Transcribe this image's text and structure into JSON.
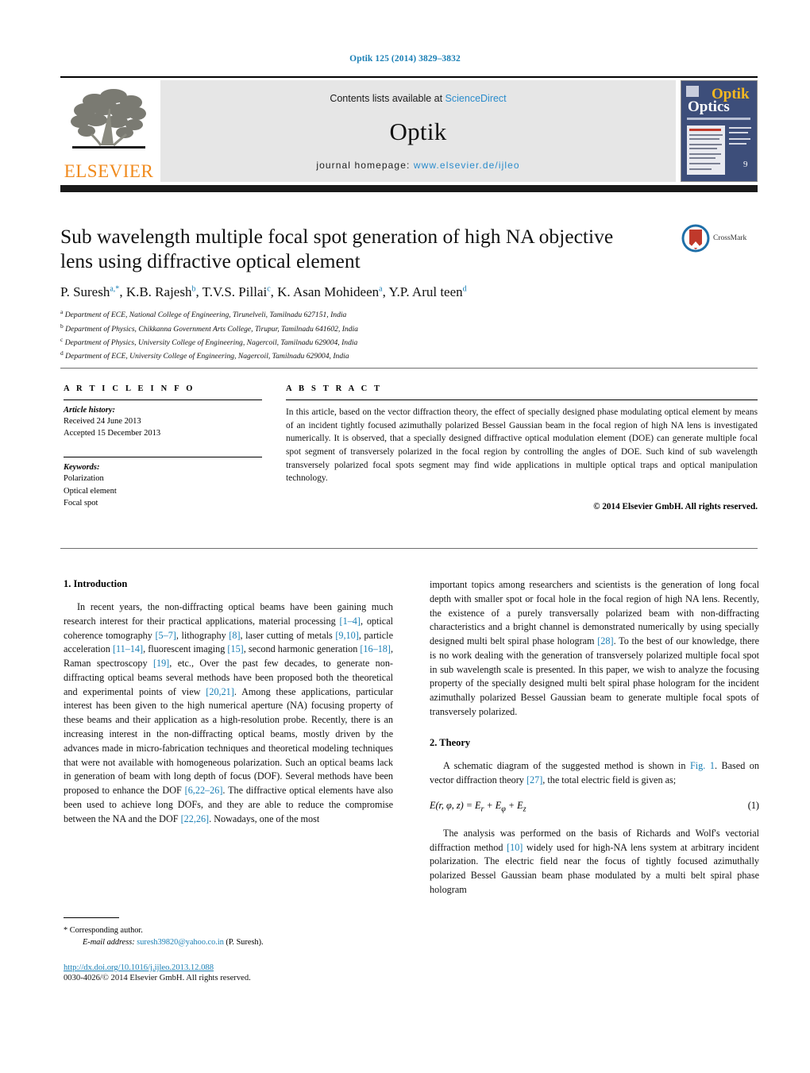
{
  "running_head": "Optik 125 (2014) 3829–3832",
  "masthead": {
    "contents_prefix": "Contents lists available at ",
    "contents_link": "ScienceDirect",
    "journal_name": "Optik",
    "homepage_prefix": "journal homepage:",
    "homepage_url": "www.elsevier.de/ijleo",
    "publisher_logo_text": "ELSEVIER",
    "cover_title_top": "Optik",
    "cover_title_bottom": "Optics"
  },
  "title": "Sub wavelength multiple focal spot generation of high NA objective lens using diffractive optical element",
  "crossmark_label": "CrossMark",
  "authors_html": "P. Suresh<sup class=\"star\">a,*</sup>, K.B. Rajesh<sup>b</sup>, T.V.S. Pillai<sup>c</sup>, K. Asan Mohideen<sup>a</sup>, Y.P. Arul teen<sup>d</sup>",
  "affiliations": [
    {
      "marker": "a",
      "text": "Department of ECE, National College of Engineering, Tirunelveli, Tamilnadu 627151, India"
    },
    {
      "marker": "b",
      "text": "Department of Physics, Chikkanna Government Arts College, Tirupur, Tamilnadu 641602, India"
    },
    {
      "marker": "c",
      "text": "Department of Physics, University College of Engineering, Nagercoil, Tamilnadu 629004, India"
    },
    {
      "marker": "d",
      "text": "Department of ECE, University College of Engineering, Nagercoil, Tamilnadu 629004, India"
    }
  ],
  "article_info": {
    "heading": "A R T I C L E   I N F O",
    "history_label": "Article history:",
    "received": "Received 24 June 2013",
    "accepted": "Accepted 15 December 2013",
    "keywords_label": "Keywords:",
    "keywords": [
      "Polarization",
      "Optical element",
      "Focal spot"
    ]
  },
  "abstract": {
    "heading": "A B S T R A C T",
    "text": "In this article, based on the vector diffraction theory, the effect of specially designed phase modulating optical element by means of an incident tightly focused azimuthally polarized Bessel Gaussian beam in the focal region of high NA lens is investigated numerically. It is observed, that a specially designed diffractive optical modulation element (DOE) can generate multiple focal spot segment of transversely polarized in the focal region by controlling the angles of DOE. Such kind of sub wavelength transversely polarized focal spots segment may find wide applications in multiple optical traps and optical manipulation technology.",
    "copyright": "© 2014 Elsevier GmbH. All rights reserved."
  },
  "body": {
    "intro_heading": "1.  Introduction",
    "intro_p1_html": "In recent years, the non-diffracting optical beams have been gaining much research interest for their practical applications, material processing <span class=\"ref\">[1–4]</span>, optical coherence tomography <span class=\"ref\">[5–7]</span>, lithography <span class=\"ref\">[8]</span>, laser cutting of metals <span class=\"ref\">[9,10]</span>, particle acceleration <span class=\"ref\">[11–14]</span>, fluorescent imaging <span class=\"ref\">[15]</span>, second harmonic generation <span class=\"ref\">[16–18]</span>, Raman spectroscopy <span class=\"ref\">[19]</span>, etc., Over the past few decades, to generate non-diffracting optical beams several methods have been proposed both the theoretical and experimental points of view <span class=\"ref\">[20,21]</span>. Among these applications, particular interest has been given to the high numerical aperture (NA) focusing property of these beams and their application as a high-resolution probe. Recently, there is an increasing interest in the non-diffracting optical beams, mostly driven by the advances made in micro-fabrication techniques and theoretical modeling techniques that were not available with homogeneous polarization. Such an optical beams lack in generation of beam with long depth of focus (DOF). Several methods have been proposed to enhance the DOF <span class=\"ref\">[6,22–26]</span>. The diffractive optical elements have also been used to achieve long DOFs, and they are able to reduce the compromise between the NA and the DOF <span class=\"ref\">[22,26]</span>. Nowadays, one of the most",
    "intro_p2_html": "important topics among researchers and scientists is the generation of long focal depth with smaller spot or focal hole in the focal region of high NA lens. Recently, the existence of a purely transversally polarized beam with non-diffracting characteristics and a bright channel is demonstrated numerically by using specially designed multi belt spiral phase hologram <span class=\"ref\">[28]</span>. To the best of our knowledge, there is no work dealing with the generation of transversely polarized multiple focal spot in sub wavelength scale is presented. In this paper, we wish to analyze the focusing property of the specially designed multi belt spiral phase hologram for the incident azimuthally polarized Bessel Gaussian beam to generate multiple focal spots of transversely polarized.",
    "theory_heading": "2.  Theory",
    "theory_p1_html": "A schematic diagram of the suggested method is shown in <span class=\"ref\">Fig. 1</span>. Based on vector diffraction theory <span class=\"ref\">[27]</span>, the total electric field is given as;",
    "equation_1": "E(r, φ, z) = E",
    "equation_1_html": "<i>E</i>(<i>r</i>, <i>φ</i>, <i>z</i>) = <i>E<sub>r</sub></i> + <i>E<sub>φ</sub></i> + <i>E<sub>z</sub></i>",
    "equation_1_number": "(1)",
    "theory_p2_html": "The analysis was performed on the basis of Richards and Wolf's vectorial diffraction method <span class=\"ref\">[10]</span> widely used for high-NA lens system at arbitrary incident polarization. The electric field near the focus of tightly focused azimuthally polarized Bessel Gaussian beam phase modulated by a multi belt spiral phase hologram"
  },
  "footnote": {
    "corresponding": "* Corresponding author.",
    "email_label": "E-mail address:",
    "email": "suresh39820@yahoo.co.in",
    "email_owner": "(P. Suresh).",
    "doi": "http://dx.doi.org/10.1016/j.ijleo.2013.12.088",
    "issn": "0030-4026/© 2014 Elsevier GmbH. All rights reserved."
  },
  "colors": {
    "link": "#1a7fb5",
    "elsevier_orange": "#f08a1c",
    "cover_blue": "#3d4e7a",
    "band_gray": "#e6e6e6"
  }
}
